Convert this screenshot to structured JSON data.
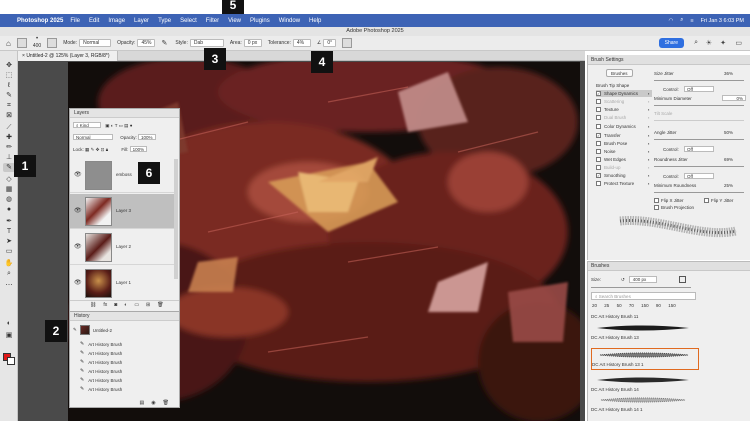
{
  "menubar": {
    "app_name": "Photoshop 2025",
    "items": [
      "File",
      "Edit",
      "Image",
      "Layer",
      "Type",
      "Select",
      "Filter",
      "View",
      "Plugins",
      "Window",
      "Help"
    ],
    "clock": "Fri Jan 3 6:03 PM"
  },
  "window_title": "Adobe Photoshop 2025",
  "options": {
    "brush_size": "400",
    "mode_label": "Mode:",
    "mode_value": "Normal",
    "opacity_label": "Opacity:",
    "opacity_value": "45%",
    "style_label": "Style:",
    "style_value": "Dab",
    "area_label": "Area:",
    "area_value": "0 px",
    "tolerance_label": "Tolerance:",
    "tolerance_value": "4%",
    "angle_value": "0°",
    "share_label": "Share"
  },
  "document_tab": "Untitled-2 @ 125% (Layer 3, RGB/8*)",
  "layers": {
    "title": "Layers",
    "kind_filter": "Kind",
    "blend_mode": "Normal",
    "opacity_label": "Opacity:",
    "opacity_value": "100%",
    "lock_label": "Lock:",
    "fill_label": "Fill:",
    "fill_value": "100%",
    "rows": [
      {
        "name": "emboss",
        "selected": false
      },
      {
        "name": "Layer 3",
        "selected": true
      },
      {
        "name": "Layer 2",
        "selected": false
      },
      {
        "name": "Layer 1",
        "selected": false
      }
    ],
    "footer_icons": [
      "link-icon",
      "fx-icon",
      "mask-icon",
      "adjustment-icon",
      "group-icon",
      "new-layer-icon",
      "trash-icon"
    ]
  },
  "history": {
    "title": "History",
    "snapshot": "Untitled-2",
    "items": [
      "Art History Brush",
      "Art History Brush",
      "Art History Brush",
      "Art History Brush",
      "Art History Brush",
      "Art History Brush"
    ]
  },
  "brush_settings": {
    "title": "Brush Settings",
    "brushes_button": "Brushes",
    "options": [
      {
        "label": "Brush Tip Shape",
        "checkbox": false,
        "checked": false,
        "dim": false,
        "selected": false
      },
      {
        "label": "Shape Dynamics",
        "checkbox": true,
        "checked": true,
        "dim": false,
        "selected": true
      },
      {
        "label": "Scattering",
        "checkbox": true,
        "checked": false,
        "dim": true,
        "selected": false
      },
      {
        "label": "Texture",
        "checkbox": true,
        "checked": false,
        "dim": false,
        "selected": false
      },
      {
        "label": "Dual Brush",
        "checkbox": true,
        "checked": false,
        "dim": true,
        "selected": false
      },
      {
        "label": "Color Dynamics",
        "checkbox": true,
        "checked": false,
        "dim": false,
        "selected": false
      },
      {
        "label": "Transfer",
        "checkbox": true,
        "checked": true,
        "dim": false,
        "selected": false
      },
      {
        "label": "Brush Pose",
        "checkbox": true,
        "checked": false,
        "dim": false,
        "selected": false
      },
      {
        "label": "Noise",
        "checkbox": true,
        "checked": false,
        "dim": false,
        "selected": false
      },
      {
        "label": "Wet Edges",
        "checkbox": true,
        "checked": false,
        "dim": false,
        "selected": false
      },
      {
        "label": "Build-up",
        "checkbox": true,
        "checked": false,
        "dim": true,
        "selected": false
      },
      {
        "label": "Smoothing",
        "checkbox": true,
        "checked": true,
        "dim": false,
        "selected": false
      },
      {
        "label": "Protect Texture",
        "checkbox": true,
        "checked": false,
        "dim": false,
        "selected": false
      }
    ],
    "size_jitter_label": "Size Jitter",
    "size_jitter_value": "36%",
    "control_label": "Control:",
    "control_value": "Off",
    "min_diameter_label": "Minimum Diameter",
    "min_diameter_value": "0%",
    "tilt_scale_label": "Tilt Scale",
    "angle_jitter_label": "Angle Jitter",
    "angle_jitter_value": "50%",
    "roundness_jitter_label": "Roundness Jitter",
    "roundness_jitter_value": "69%",
    "min_roundness_label": "Minimum Roundness",
    "min_roundness_value": "25%",
    "flip_x_label": "Flip X Jitter",
    "flip_y_label": "Flip Y Jitter",
    "brush_projection_label": "Brush Projection"
  },
  "brushes": {
    "title": "Brushes",
    "size_label": "Size:",
    "size_value": "400 px",
    "search_placeholder": "Search Brushes",
    "sizes": [
      "20",
      "25",
      "50",
      "70",
      "150",
      "90",
      "150"
    ],
    "entries": [
      "DC Art History Brush 11",
      "DC Art History Brush 13",
      "DC Art History Brush 13 1",
      "DC Art History Brush 14",
      "DC Art History Brush 14 1"
    ]
  },
  "callouts": [
    "1",
    "2",
    "3",
    "4",
    "5",
    "6"
  ],
  "colors": {
    "menubar": "#3d63b5",
    "accent": "#2f6fe0",
    "selection_outline": "#e06a20",
    "foreground": "#e01818"
  }
}
